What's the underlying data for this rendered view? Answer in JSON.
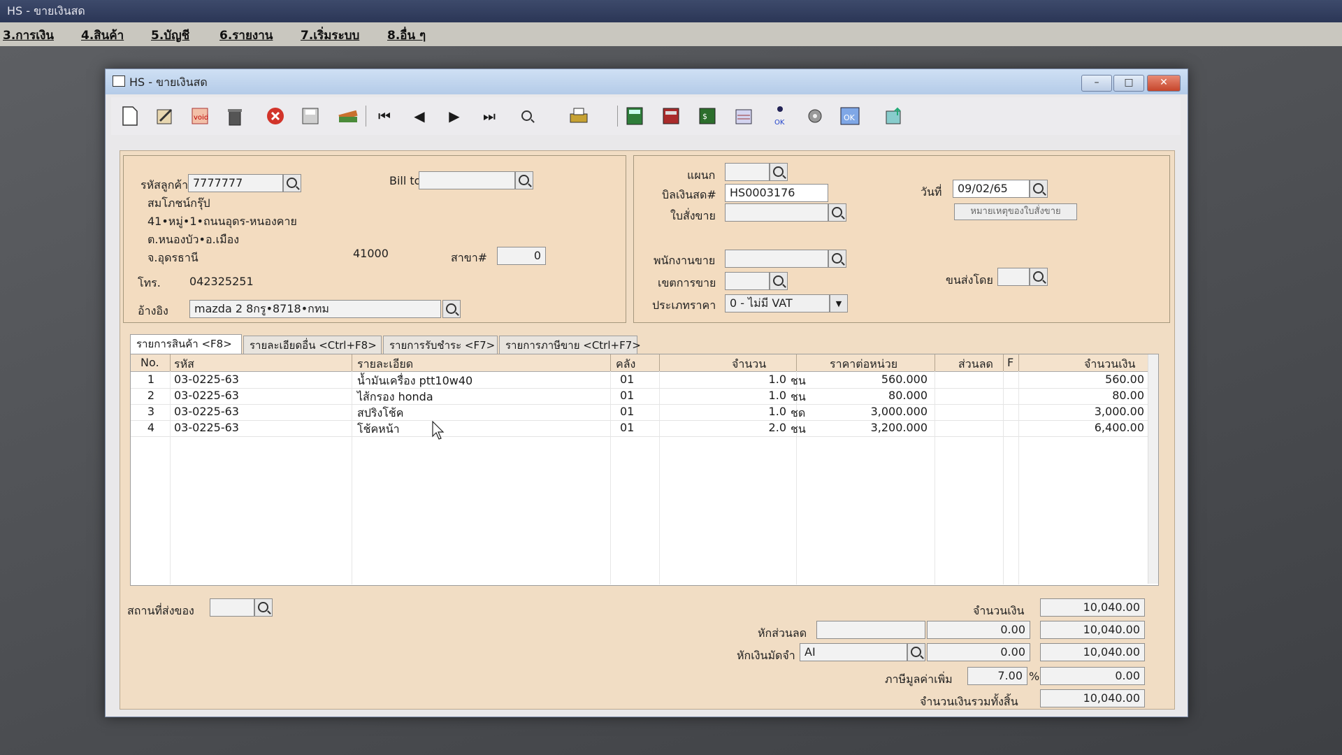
{
  "app_title": "HS - ขายเงินสด",
  "menu": [
    "3.การเงิน",
    "4.สินค้า",
    "5.บัญชี",
    "6.รายงาน",
    "7.เริ่มระบบ",
    "8.อื่น ๆ"
  ],
  "window": {
    "title": "HS - ขายเงินสด",
    "min": "–",
    "max": "□",
    "close": "✕"
  },
  "toolbar_icons": [
    "new-document-icon",
    "edit-icon",
    "void-icon",
    "trash-icon",
    "cancel-icon",
    "save-icon",
    "books-icon",
    "first-record-icon",
    "previous-record-icon",
    "next-record-icon",
    "last-record-icon",
    "find-icon",
    "print-icon",
    "calculator-icon",
    "register-icon",
    "money-icon",
    "report-icon",
    "approve-icon",
    "tools-icon",
    "ok-icon",
    "export-icon"
  ],
  "customer": {
    "code_label": "รหัสลูกค้า",
    "code": "7777777",
    "name": "สมโภชน์กรุ๊ป",
    "addr1": "41•หมู่•1•ถนนอุดร-หนองคาย",
    "addr2": "ต.หนองบัว•อ.เมือง",
    "province": "จ.อุดรธานี",
    "zip": "41000",
    "branch_label": "สาขา#",
    "branch": "0",
    "phone_label": "โทร.",
    "phone": "042325251",
    "ref_label": "อ้างอิง",
    "ref": "mazda 2 8กรู•8718•กทม",
    "bill_to_label": "Bill to",
    "bill_to": ""
  },
  "doc": {
    "dept_label": "แผนก",
    "dept": "",
    "cash_bill_label": "บิลเงินสด#",
    "cash_bill": "HS0003176",
    "so_label": "ใบสั่งขาย",
    "so": "",
    "date_label": "วันที่",
    "date": "09/02/65",
    "so_note_button": "หมายเหตุของใบสั่งขาย",
    "salesman_label": "พนักงานขาย",
    "salesman": "",
    "area_label": "เขตการขาย",
    "area": "",
    "ship_label": "ขนส่งโดย",
    "ship": "",
    "price_type_label": "ประเภทราคา",
    "price_type": "0 - ไม่มี VAT"
  },
  "tabs": [
    "รายการสินค้า <F8>",
    "รายละเอียดอื่น <Ctrl+F8>",
    "รายการรับชำระ <F7>",
    "รายการภาษีขาย <Ctrl+F7>"
  ],
  "columns": {
    "no": "No.",
    "code": "รหัส",
    "desc": "รายละเอียด",
    "wh": "คลัง",
    "qty": "จำนวน",
    "price": "ราคาต่อหน่วย",
    "disc": "ส่วนลด",
    "f": "F",
    "amount": "จำนวนเงิน"
  },
  "rows": [
    {
      "no": "1",
      "code": "03-0225-63",
      "desc": "น้ำมันเครื่อง ptt10w40",
      "wh": "01",
      "qty": "1.0",
      "unit": "ชน",
      "price": "560.000",
      "disc": "",
      "amount": "560.00"
    },
    {
      "no": "2",
      "code": "03-0225-63",
      "desc": "ไส้กรอง honda",
      "wh": "01",
      "qty": "1.0",
      "unit": "ชน",
      "price": "80.000",
      "disc": "",
      "amount": "80.00"
    },
    {
      "no": "3",
      "code": "03-0225-63",
      "desc": "สปริงโช้ค",
      "wh": "01",
      "qty": "1.0",
      "unit": "ชด",
      "price": "3,000.000",
      "disc": "",
      "amount": "3,000.00"
    },
    {
      "no": "4",
      "code": "03-0225-63",
      "desc": "โช้คหน้า",
      "wh": "01",
      "qty": "2.0",
      "unit": "ชน",
      "price": "3,200.000",
      "disc": "",
      "amount": "6,400.00"
    }
  ],
  "footer": {
    "ship_to_label": "สถานที่ส่งของ",
    "ship_to": "",
    "amount_label": "จำนวนเงิน",
    "amount": "10,040.00",
    "discount_label": "หักส่วนลด",
    "discount_code": "",
    "discount": "0.00",
    "after_discount": "10,040.00",
    "deposit_label": "หักเงินมัดจำ",
    "deposit_code": "AI",
    "deposit": "0.00",
    "after_deposit": "10,040.00",
    "vat_label": "ภาษีมูลค่าเพิ่ม",
    "vat_rate": "7.00",
    "vat_pct": "%",
    "vat": "0.00",
    "total_label": "จำนวนเงินรวมทั้งสิ้น",
    "total": "10,040.00"
  }
}
